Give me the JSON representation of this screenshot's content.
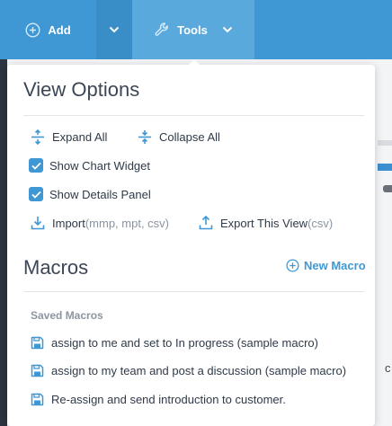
{
  "toolbar": {
    "add_label": "Add",
    "tools_label": "Tools",
    "colors": {
      "bar": "#3f98d4",
      "active": "#5aa9dd"
    }
  },
  "view_options": {
    "title": "View Options",
    "expand_all": "Expand All",
    "collapse_all": "Collapse All",
    "show_chart_widget": {
      "label": "Show Chart Widget",
      "checked": true
    },
    "show_details_panel": {
      "label": "Show Details Panel",
      "checked": true
    },
    "import": {
      "label": "Import",
      "formats": "(mmp, mpt, csv)"
    },
    "export": {
      "label": "Export This View",
      "format": "(csv)"
    }
  },
  "macros": {
    "title": "Macros",
    "new_macro_label": "New Macro",
    "saved_label": "Saved Macros",
    "items": [
      {
        "label": "assign to me and set to In progress (sample macro)"
      },
      {
        "label": "assign to my team and post a discussion (sample macro)"
      },
      {
        "label": "Re-assign and send introduction to customer."
      }
    ]
  },
  "background": {
    "partial_text": "c"
  }
}
